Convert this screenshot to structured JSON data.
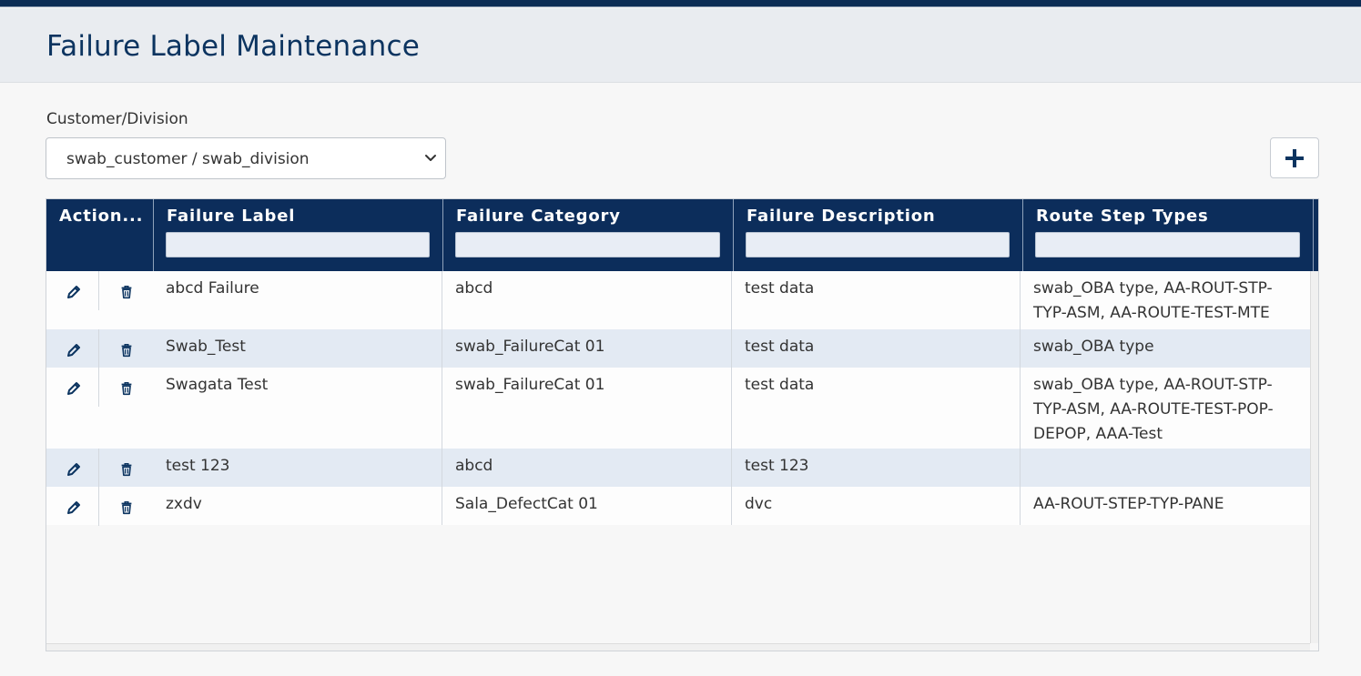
{
  "page": {
    "title": "Failure Label Maintenance"
  },
  "filter": {
    "label": "Customer/Division",
    "selected": "swab_customer / swab_division"
  },
  "toolbar": {
    "add_label": "+"
  },
  "grid": {
    "columns": [
      "Action...",
      "Failure Label",
      "Failure Category",
      "Failure Description",
      "Route Step Types"
    ],
    "rows": [
      {
        "label": "abcd Failure",
        "category": "abcd",
        "description": "test data",
        "route_lines": [
          "swab_OBA type, AA-ROUT-STP-",
          "TYP-ASM, AA-ROUTE-TEST-MTE"
        ]
      },
      {
        "label": "Swab_Test",
        "category": "swab_FailureCat 01",
        "description": "test data",
        "route_lines": [
          "swab_OBA type"
        ]
      },
      {
        "label": "Swagata Test",
        "category": "swab_FailureCat 01",
        "description": "test data",
        "route_lines": [
          "swab_OBA type, AA-ROUT-STP-",
          "TYP-ASM, AA-ROUTE-TEST-POP-",
          "DEPOP, AAA-Test"
        ]
      },
      {
        "label": "test 123",
        "category": "abcd",
        "description": "test 123",
        "route_lines": []
      },
      {
        "label": "zxdv",
        "category": "Sala_DefectCat 01",
        "description": "dvc",
        "route_lines": [
          "AA-ROUT-STEP-TYP-PANE"
        ]
      }
    ]
  },
  "colors": {
    "header": "#0c2d5b",
    "title": "#0c3460",
    "alt_row": "#e3eaf3"
  },
  "icons": {
    "edit": "pencil-icon",
    "delete": "trash-icon",
    "add": "plus-icon",
    "select": "chevron-down-icon"
  }
}
